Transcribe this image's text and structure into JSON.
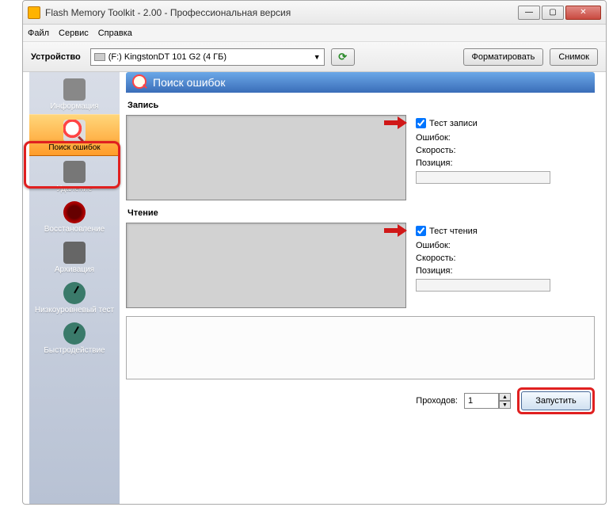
{
  "window": {
    "title": "Flash Memory Toolkit - 2.00 - Профессиональная версия"
  },
  "menu": {
    "file": "Файл",
    "service": "Сервис",
    "help": "Справка"
  },
  "toolbar": {
    "device_label": "Устройство",
    "device_selected": "(F:) KingstonDT 101 G2 (4 ГБ)",
    "format_btn": "Форматировать",
    "snapshot_btn": "Снимок"
  },
  "sidebar": {
    "items": [
      {
        "label": "Информация"
      },
      {
        "label": "Поиск ошибок"
      },
      {
        "label": "Удаление"
      },
      {
        "label": "Восстановление"
      },
      {
        "label": "Архивация"
      },
      {
        "label": "Низкоуровневый тест"
      },
      {
        "label": "Быстродействие"
      }
    ]
  },
  "panel": {
    "title": "Поиск ошибок",
    "write_section": "Запись",
    "read_section": "Чтение",
    "write_test_label": "Тест записи",
    "read_test_label": "Тест чтения",
    "errors_label": "Ошибок:",
    "speed_label": "Скорость:",
    "position_label": "Позиция:",
    "passes_label": "Проходов:",
    "passes_value": "1",
    "run_btn": "Запустить"
  }
}
